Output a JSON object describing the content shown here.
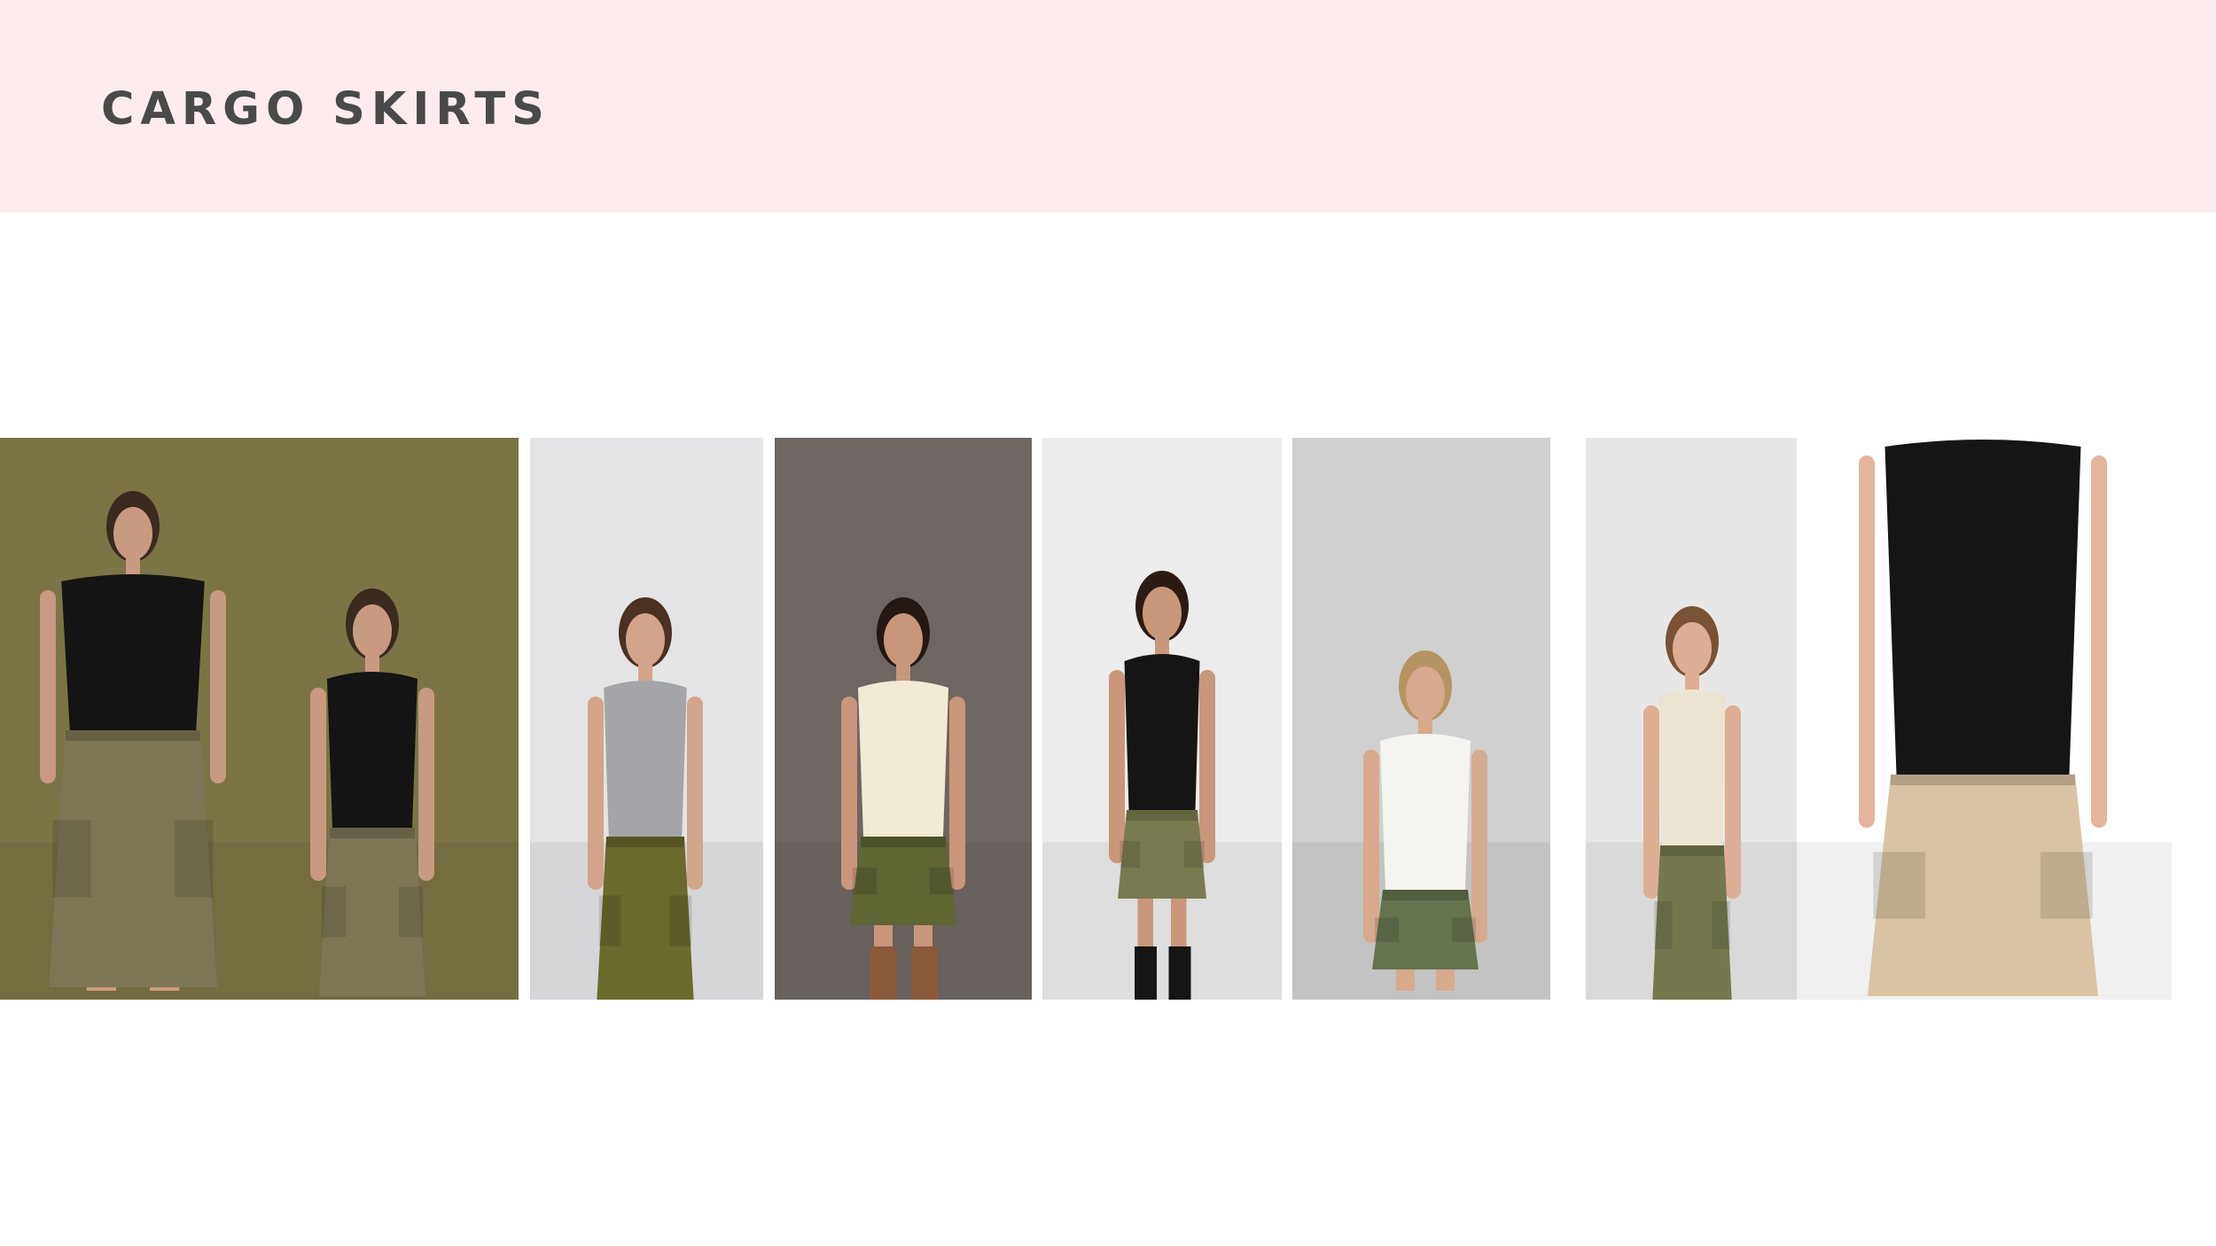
{
  "header": {
    "title": "CARGO SKIRTS",
    "background_color": "#fdecee",
    "title_color": "#4a4a4a"
  },
  "gallery": {
    "photos": [
      {
        "name": "olive-maxi-cargo-skirt-photo",
        "backdrop": "#7b7445",
        "top": "#141414",
        "skirt": "#7d7657",
        "skin": "#c99a82",
        "hair": "#3a2a1f",
        "shoes": "#161616"
      },
      {
        "name": "olive-midi-cargo-skirt-hoodie-photo",
        "backdrop": "#e4e4e6",
        "top": "#a3a5a8",
        "skirt": "#6a6a2c",
        "skin": "#d2a48a",
        "hair": "#4a3121",
        "shoes": "#111111"
      },
      {
        "name": "olive-mini-cargo-skirt-blouse-photo",
        "backdrop": "#6e6662",
        "top": "#f1ead4",
        "skirt": "#5f6533",
        "skin": "#c8977b",
        "hair": "#231813",
        "shoes": "#8b5a3a"
      },
      {
        "name": "wrap-cargo-mini-skirt-boots-photo",
        "backdrop": "#ececec",
        "top": "#151515",
        "skirt": "#7a7a50",
        "skin": "#c9977a",
        "hair": "#2a1c14",
        "shoes": "#151515"
      },
      {
        "name": "khaki-cargo-mini-skirt-white-top-photo",
        "backdrop": "#d0d0d0",
        "top": "#f6f4f0",
        "skirt": "#65734f",
        "skin": "#d6aa8c",
        "hair": "#b59463",
        "shoes": "#1d1d1d"
      },
      {
        "name": "midi-cargo-skirt-knit-sweater-photo",
        "backdrop": "#e7e7e7",
        "top": "#ece4d2",
        "skirt": "#75784f",
        "skin": "#dcae94",
        "hair": "#7a5235",
        "shoes": "#f6f6f6"
      },
      {
        "name": "beige-cargo-mini-skirt-belt-photo",
        "backdrop": "#ffffff",
        "top": "#151515",
        "skirt": "#d8c4a3",
        "skin": "#e3b49e",
        "hair": "#151515",
        "shoes": "#151515"
      }
    ]
  }
}
